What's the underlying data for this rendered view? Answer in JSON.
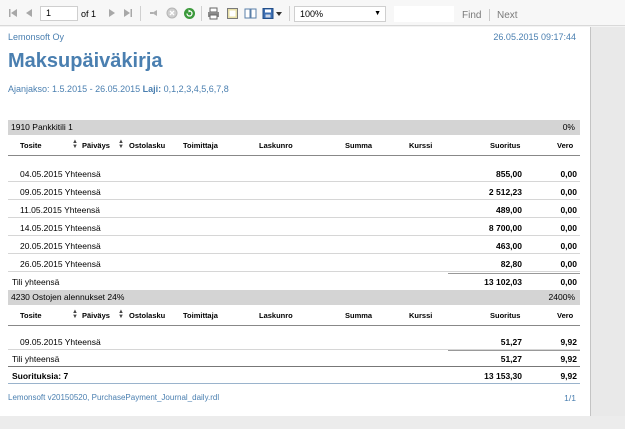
{
  "toolbar": {
    "page_number": "1",
    "of_label": "of 1",
    "zoom": "100%",
    "find_label": "Find",
    "next_label": "Next"
  },
  "report": {
    "company": "Lemonsoft Oy",
    "print_datetime": "26.05.2015 09:17:44",
    "title": "Maksupäiväkirja",
    "period_label": "Ajanjakso:",
    "period_value": "1.5.2015 - 26.05.2015",
    "type_label": "Laji:",
    "type_value": "0,1,2,3,4,5,6,7,8",
    "columns": [
      "Tosite",
      "Päiväys",
      "Ostolasku",
      "Toimittaja",
      "Laskunro",
      "Summa",
      "Kurssi",
      "Suoritus",
      "Vero"
    ],
    "groups": [
      {
        "name": "1910 Pankkitili 1",
        "percent": "0%",
        "rows": [
          {
            "label": "04.05.2015 Yhteensä",
            "payment": "855,00",
            "vat": "0,00"
          },
          {
            "label": "09.05.2015 Yhteensä",
            "payment": "2 512,23",
            "vat": "0,00"
          },
          {
            "label": "11.05.2015 Yhteensä",
            "payment": "489,00",
            "vat": "0,00"
          },
          {
            "label": "14.05.2015 Yhteensä",
            "payment": "8 700,00",
            "vat": "0,00"
          },
          {
            "label": "20.05.2015 Yhteensä",
            "payment": "463,00",
            "vat": "0,00"
          },
          {
            "label": "26.05.2015 Yhteensä",
            "payment": "82,80",
            "vat": "0,00"
          }
        ],
        "total_label": "Tili yhteensä",
        "total_payment": "13 102,03",
        "total_vat": "0,00"
      },
      {
        "name": "4230 Ostojen alennukset 24%",
        "percent": "2400%",
        "rows": [
          {
            "label": "09.05.2015 Yhteensä",
            "payment": "51,27",
            "vat": "9,92"
          }
        ],
        "total_label": "Tili yhteensä",
        "total_payment": "51,27",
        "total_vat": "9,92"
      }
    ],
    "grand_label": "Suorituksia: 7",
    "grand_payment": "13 153,30",
    "grand_vat": "9,92",
    "footer_left": "Lemonsoft v20150520, PurchasePayment_Journal_daily.rdl",
    "footer_right": "1/1"
  }
}
